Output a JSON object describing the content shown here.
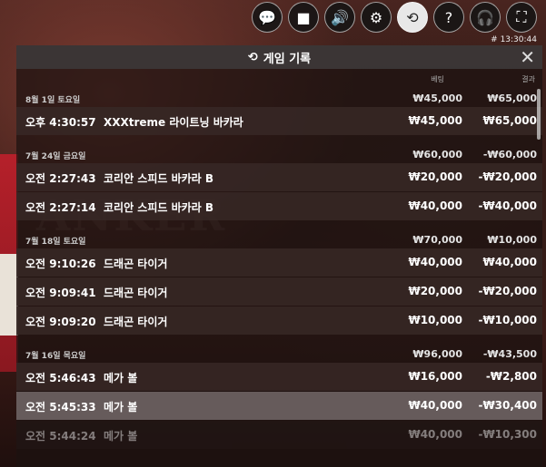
{
  "toolbar": {
    "buttons": [
      {
        "icon": "chat-icon",
        "glyph": "💬"
      },
      {
        "icon": "video-icon",
        "glyph": "■"
      },
      {
        "icon": "volume-icon",
        "glyph": "🔊"
      },
      {
        "icon": "settings-icon",
        "glyph": "⚙"
      },
      {
        "icon": "history-icon",
        "glyph": "⟲",
        "active": true
      },
      {
        "icon": "help-icon",
        "glyph": "?"
      },
      {
        "icon": "support-icon",
        "glyph": "🎧"
      },
      {
        "icon": "fullscreen-icon",
        "glyph": "⛶"
      }
    ]
  },
  "clock": "# 13:30:44",
  "panel": {
    "title": "게임 기록",
    "close": "✕",
    "col_bet": "베팅",
    "col_result": "결과"
  },
  "groups": [
    {
      "date": "8월 1일 토요일",
      "bet": "₩45,000",
      "result": "₩65,000",
      "rows": [
        {
          "time": "오후 4:30:57",
          "game": "XXXtreme 라이트닝 바카라",
          "bet": "₩45,000",
          "result": "₩65,000"
        }
      ]
    },
    {
      "date": "7월 24일 금요일",
      "bet": "₩60,000",
      "result": "-₩60,000",
      "rows": [
        {
          "time": "오전 2:27:43",
          "game": "코리안 스피드 바카라 B",
          "bet": "₩20,000",
          "result": "-₩20,000"
        },
        {
          "time": "오전 2:27:14",
          "game": "코리안 스피드 바카라 B",
          "bet": "₩40,000",
          "result": "-₩40,000"
        }
      ]
    },
    {
      "date": "7월 18일 토요일",
      "bet": "₩70,000",
      "result": "₩10,000",
      "rows": [
        {
          "time": "오전 9:10:26",
          "game": "드래곤 타이거",
          "bet": "₩40,000",
          "result": "₩40,000"
        },
        {
          "time": "오전 9:09:41",
          "game": "드래곤 타이거",
          "bet": "₩20,000",
          "result": "-₩20,000"
        },
        {
          "time": "오전 9:09:20",
          "game": "드래곤 타이거",
          "bet": "₩10,000",
          "result": "-₩10,000"
        }
      ]
    },
    {
      "date": "7월 16일 목요일",
      "bet": "₩96,000",
      "result": "-₩43,500",
      "rows": [
        {
          "time": "오전 5:46:43",
          "game": "메가 볼",
          "bet": "₩16,000",
          "result": "-₩2,800"
        },
        {
          "time": "오전 5:45:33",
          "game": "메가 볼",
          "bet": "₩40,000",
          "result": "-₩30,400",
          "highlight": true
        },
        {
          "time": "오전 5:44:24",
          "game": "메가 볼",
          "bet": "₩40,000",
          "result": "-₩10,300",
          "faded": true
        }
      ]
    }
  ]
}
